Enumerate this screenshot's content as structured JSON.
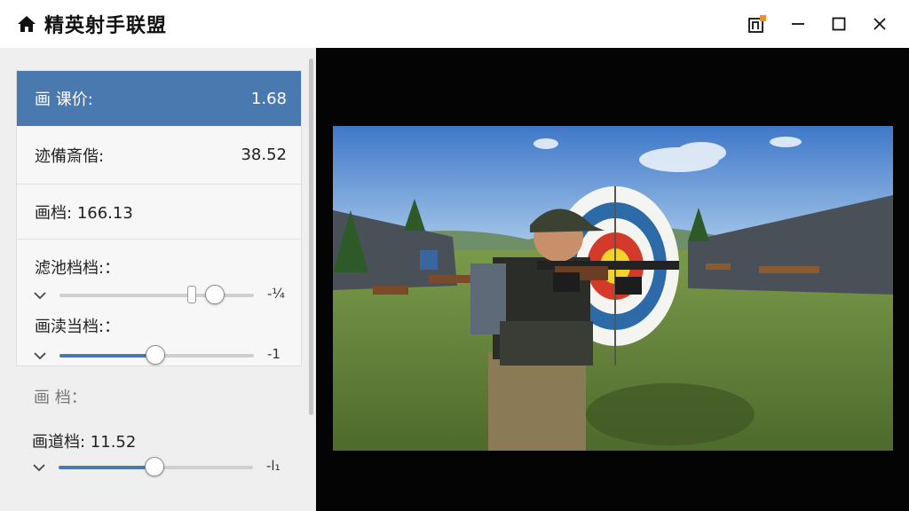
{
  "titlebar": {
    "app_title": "精英射手联盟",
    "icons": [
      "home-icon",
      "pin-icon",
      "minimize-icon",
      "maximize-icon",
      "close-icon"
    ]
  },
  "panel": {
    "rows": [
      {
        "label": "画 课价:",
        "value": "1.68"
      },
      {
        "label": "迹備斎偕:",
        "value": "38.52"
      },
      {
        "label": "画档:",
        "value": "166.13"
      }
    ],
    "sliders": [
      {
        "label": "滤池档档:：",
        "end_label": "-¼",
        "value_fraction": 0.8
      },
      {
        "label": "画渎当档:：",
        "end_label": "-1",
        "value_fraction": 0.49
      }
    ],
    "section_title": "画 档：",
    "section_slider": {
      "label": "画道档: 11.52",
      "end_label": "-l₁",
      "value_fraction": 0.49
    }
  },
  "colors": {
    "accent": "#4a79b0",
    "panel_bg": "#efefef",
    "viewport_bg": "#040404"
  }
}
